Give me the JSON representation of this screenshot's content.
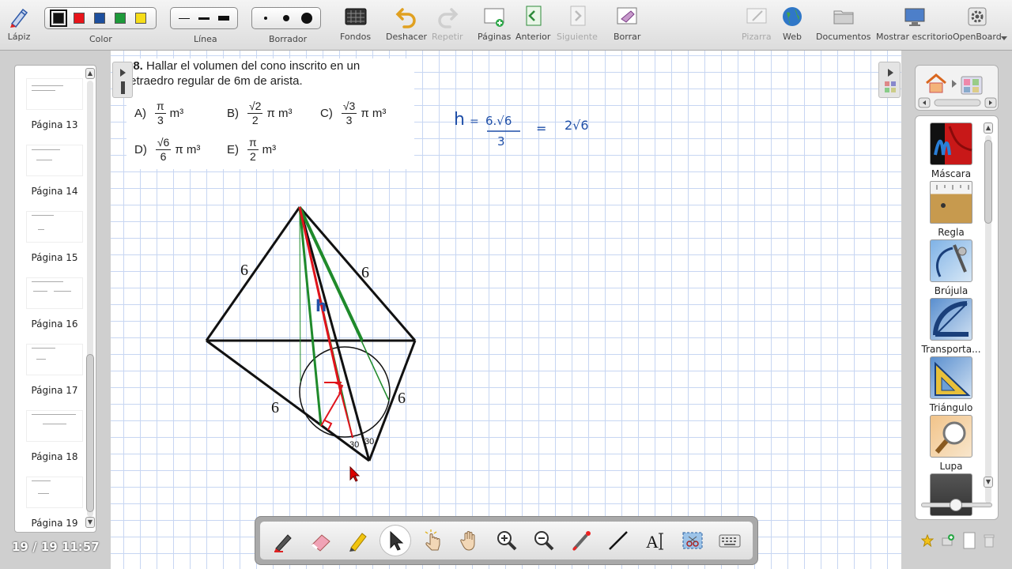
{
  "toolbar": {
    "lapiz": "Lápiz",
    "color": "Color",
    "linea": "Línea",
    "borrador": "Borrador",
    "fondos": "Fondos",
    "deshacer": "Deshacer",
    "repetir": "Repetir",
    "paginas": "Páginas",
    "anterior": "Anterior",
    "siguiente": "Siguiente",
    "borrar": "Borrar",
    "pizarra": "Pizarra",
    "web": "Web",
    "documentos": "Documentos",
    "mostrar_escritorio": "Mostrar escritorio",
    "openboard": "OpenBoard",
    "colors": [
      "#111111",
      "#e8141a",
      "#1d4f9e",
      "#1e9a3a",
      "#f6dd18"
    ]
  },
  "pages": {
    "items": [
      {
        "label": "Página 13"
      },
      {
        "label": "Página 14"
      },
      {
        "label": "Página 15"
      },
      {
        "label": "Página 16"
      },
      {
        "label": "Página 17"
      },
      {
        "label": "Página 18"
      },
      {
        "label": "Página 19"
      }
    ],
    "indicator": "19 / 19 11:57"
  },
  "problem": {
    "number": "18.",
    "text_line1": "Hallar el volumen del cono inscrito en un",
    "text_line2": "tetraedro regular de 6m de arista.",
    "options": [
      {
        "letter": "A)",
        "num": "π",
        "den": "3",
        "tail": "m³"
      },
      {
        "letter": "B)",
        "num": "√2",
        "den": "2",
        "tail": "π m³"
      },
      {
        "letter": "C)",
        "num": "√3",
        "den": "3",
        "tail": "π m³"
      },
      {
        "letter": "D)",
        "num": "√6",
        "den": "6",
        "tail": "π m³"
      },
      {
        "letter": "E)",
        "num": "π",
        "den": "2",
        "tail": "m³"
      }
    ]
  },
  "figure": {
    "edge_label_left_top": "6",
    "edge_label_right_top": "6",
    "edge_label_left_bottom": "6",
    "edge_label_right_bottom": "6",
    "height_label": "h",
    "angle_left": "30",
    "angle_right": "30"
  },
  "handwriting": {
    "h": "h",
    "eq1": "=",
    "numerator": "6.√6",
    "denominator": "3",
    "eq2": "=",
    "result": "2√6"
  },
  "library": {
    "tools": [
      {
        "name": "Máscara"
      },
      {
        "name": "Regla"
      },
      {
        "name": "Brújula"
      },
      {
        "name": "Transporta..."
      },
      {
        "name": "Triángulo"
      },
      {
        "name": "Lupa"
      }
    ]
  }
}
